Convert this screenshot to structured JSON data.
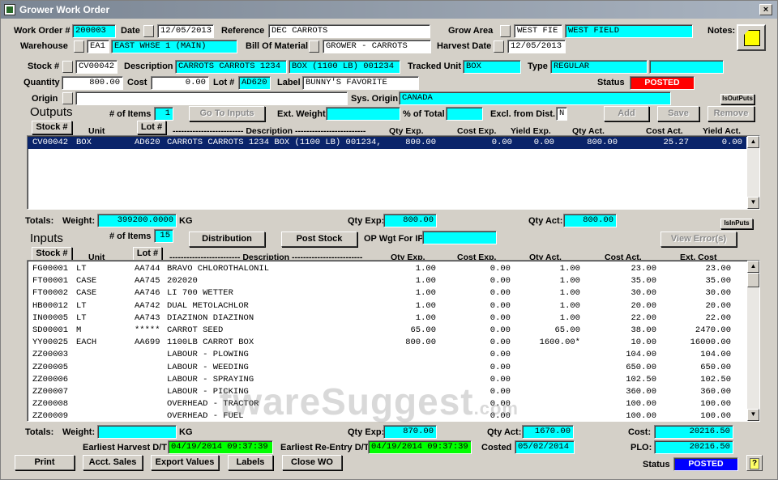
{
  "window": {
    "title": "Grower Work Order",
    "close_glyph": "×"
  },
  "header": {
    "work_order_label": "Work Order #",
    "work_order": "200003",
    "date_label": "Date",
    "date": "12/05/2013",
    "reference_label": "Reference",
    "reference": "DEC CARROTS",
    "grow_area_label": "Grow Area",
    "grow_area_code": "WEST FIE",
    "grow_area_name": "WEST FIELD",
    "notes_label": "Notes:",
    "warehouse_label": "Warehouse",
    "warehouse_code": "EA1",
    "warehouse_name": "EAST WHSE 1 (MAIN)",
    "bom_label": "Bill Of Material",
    "bom": "GROWER - CARROTS",
    "harvest_date_label": "Harvest Date",
    "harvest_date": "12/05/2013"
  },
  "stock": {
    "stock_label": "Stock #",
    "stock": "CV00042",
    "description_label": "Description",
    "description1": "CARROTS CARROTS 1234",
    "description2": "BOX (1100 LB) 001234",
    "tracked_unit_label": "Tracked Unit",
    "tracked_unit": "BOX",
    "type_label": "Type",
    "type": "REGULAR",
    "type_extra": "",
    "quantity_label": "Quantity",
    "quantity": "800.00",
    "cost_label": "Cost",
    "cost": "0.00",
    "lot_label": "Lot #",
    "lot": "AD620",
    "label_label": "Label",
    "label": "BUNNY'S FAVORITE",
    "status_label": "Status",
    "status": "POSTED",
    "origin_label": "Origin",
    "origin": "",
    "sys_origin_label": "Sys. Origin",
    "sys_origin": "CANADA",
    "is_out_puts": "IsOutPuts"
  },
  "outputs": {
    "title": "Outputs",
    "items_label": "# of Items",
    "items_count": "1",
    "go_to_inputs": "Go To Inputs",
    "ext_weight_label": "Ext. Weight",
    "ext_weight": "",
    "pct_total_label": "% of Total",
    "pct_total": "",
    "excl_label": "Excl. from Dist.",
    "excl": "N",
    "add": "Add",
    "save": "Save",
    "remove": "Remove",
    "stock_btn": "Stock #",
    "unit_hdr": "Unit",
    "lot_btn": "Lot #",
    "desc_hdr": "------------------------- Description -------------------------",
    "qty_exp_hdr": "Qty Exp.",
    "cost_exp_hdr": "Cost Exp.",
    "yield_exp_hdr": "Yield Exp.",
    "qty_act_hdr": "Qty Act.",
    "cost_act_hdr": "Cost Act.",
    "yield_act_hdr": "Yield Act.",
    "rows": [
      {
        "stock": "CV00042",
        "unit": "BOX",
        "lot": "AD620",
        "desc": "CARROTS CARROTS 1234 BOX (1100 LB) 001234,",
        "qty_exp": "800.00",
        "cost_exp": "0.00",
        "yield_exp": "0.00",
        "qty_act": "800.00",
        "cost_act": "25.27",
        "yield_act": "0.00"
      }
    ],
    "totals_label": "Totals:",
    "weight_label": "Weight:",
    "weight": "399200.0000",
    "weight_unit": "KG",
    "qty_exp_label": "Qty Exp:",
    "qty_exp_total": "800.00",
    "qty_act_label": "Qty Act:",
    "qty_act_total": "800.00",
    "is_in_puts": "IsInPuts"
  },
  "inputs": {
    "title": "Inputs",
    "items_label": "# of Items",
    "items_count": "15",
    "distribution": "Distribution",
    "post_stock": "Post Stock",
    "op_wgt_label": "OP Wgt For IP",
    "op_wgt": "",
    "view_errors": "View Error(s)",
    "stock_btn": "Stock #",
    "unit_hdr": "Unit",
    "lot_btn": "Lot #",
    "desc_hdr": "------------------------- Description -------------------------",
    "qty_exp_hdr": "Qty Exp.",
    "cost_exp_hdr": "Cost Exp.",
    "qty_act_hdr": "Qty Act.",
    "cost_act_hdr": "Cost Act.",
    "ext_cost_hdr": "Ext. Cost",
    "rows": [
      {
        "stock": "FG00001",
        "unit": "LT",
        "lot": "AA744",
        "desc": "BRAVO CHLOROTHALONIL",
        "qty_exp": "1.00",
        "cost_exp": "0.00",
        "qty_act": "1.00",
        "cost_act": "23.00",
        "ext_cost": "23.00"
      },
      {
        "stock": "FT00001",
        "unit": "CASE",
        "lot": "AA745",
        "desc": "202020",
        "qty_exp": "1.00",
        "cost_exp": "0.00",
        "qty_act": "1.00",
        "cost_act": "35.00",
        "ext_cost": "35.00"
      },
      {
        "stock": "FT00002",
        "unit": "CASE",
        "lot": "AA746",
        "desc": "LI 700 WETTER",
        "qty_exp": "1.00",
        "cost_exp": "0.00",
        "qty_act": "1.00",
        "cost_act": "30.00",
        "ext_cost": "30.00"
      },
      {
        "stock": "HB00012",
        "unit": "LT",
        "lot": "AA742",
        "desc": "DUAL METOLACHLOR",
        "qty_exp": "1.00",
        "cost_exp": "0.00",
        "qty_act": "1.00",
        "cost_act": "20.00",
        "ext_cost": "20.00"
      },
      {
        "stock": "IN00005",
        "unit": "LT",
        "lot": "AA743",
        "desc": "DIAZINON DIAZINON",
        "qty_exp": "1.00",
        "cost_exp": "0.00",
        "qty_act": "1.00",
        "cost_act": "22.00",
        "ext_cost": "22.00"
      },
      {
        "stock": "SD00001",
        "unit": "M",
        "lot": "*****",
        "desc": "CARROT SEED",
        "qty_exp": "65.00",
        "cost_exp": "0.00",
        "qty_act": "65.00",
        "cost_act": "38.00",
        "ext_cost": "2470.00"
      },
      {
        "stock": "YY00025",
        "unit": "EACH",
        "lot": "AA699",
        "desc": "1100LB CARROT BOX",
        "qty_exp": "800.00",
        "cost_exp": "0.00",
        "qty_act": "1600.00*",
        "cost_act": "10.00",
        "ext_cost": "16000.00"
      },
      {
        "stock": "ZZ00003",
        "unit": "",
        "lot": "",
        "desc": "LABOUR - PLOWING",
        "qty_exp": "",
        "cost_exp": "0.00",
        "qty_act": "",
        "cost_act": "104.00",
        "ext_cost": "104.00"
      },
      {
        "stock": "ZZ00005",
        "unit": "",
        "lot": "",
        "desc": "LABOUR - WEEDING",
        "qty_exp": "",
        "cost_exp": "0.00",
        "qty_act": "",
        "cost_act": "650.00",
        "ext_cost": "650.00"
      },
      {
        "stock": "ZZ00006",
        "unit": "",
        "lot": "",
        "desc": "LABOUR - SPRAYING",
        "qty_exp": "",
        "cost_exp": "0.00",
        "qty_act": "",
        "cost_act": "102.50",
        "ext_cost": "102.50"
      },
      {
        "stock": "ZZ00007",
        "unit": "",
        "lot": "",
        "desc": "LABOUR - PICKING",
        "qty_exp": "",
        "cost_exp": "0.00",
        "qty_act": "",
        "cost_act": "360.00",
        "ext_cost": "360.00"
      },
      {
        "stock": "ZZ00008",
        "unit": "",
        "lot": "",
        "desc": "OVERHEAD - TRACTOR",
        "qty_exp": "",
        "cost_exp": "0.00",
        "qty_act": "",
        "cost_act": "100.00",
        "ext_cost": "100.00"
      },
      {
        "stock": "ZZ00009",
        "unit": "",
        "lot": "",
        "desc": "OVERHEAD - FUEL",
        "qty_exp": "",
        "cost_exp": "0.00",
        "qty_act": "",
        "cost_act": "100.00",
        "ext_cost": "100.00"
      }
    ],
    "totals_label": "Totals:",
    "weight_label": "Weight:",
    "weight": "",
    "weight_unit": "KG",
    "qty_exp_label": "Qty Exp:",
    "qty_exp_total": "870.00",
    "qty_act_label": "Qty Act:",
    "qty_act_total": "1670.00",
    "cost_label": "Cost:",
    "cost_total": "20216.50",
    "earliest_harvest_label": "Earliest Harvest D/T",
    "earliest_harvest": "04/19/2014 09:37:39",
    "earliest_reentry_label": "Earliest Re-Entry D/T",
    "earliest_reentry": "04/19/2014 09:37:39",
    "costed_label": "Costed",
    "costed": "05/02/2014",
    "plo_label": "PLO:",
    "plo": "20216.50"
  },
  "footer": {
    "print": "Print",
    "acct_sales": "Acct. Sales",
    "export_values": "Export Values",
    "labels": "Labels",
    "close_wo": "Close WO",
    "status_label": "Status",
    "status": "POSTED"
  },
  "watermark": {
    "main": "twareSuggest",
    "suffix": ".com"
  },
  "colors": {
    "field_cyan": "#00ffff",
    "field_green": "#00ff00",
    "status_red": "#ff0000",
    "status_blue": "#0000ff",
    "selection": "#0a246a"
  }
}
